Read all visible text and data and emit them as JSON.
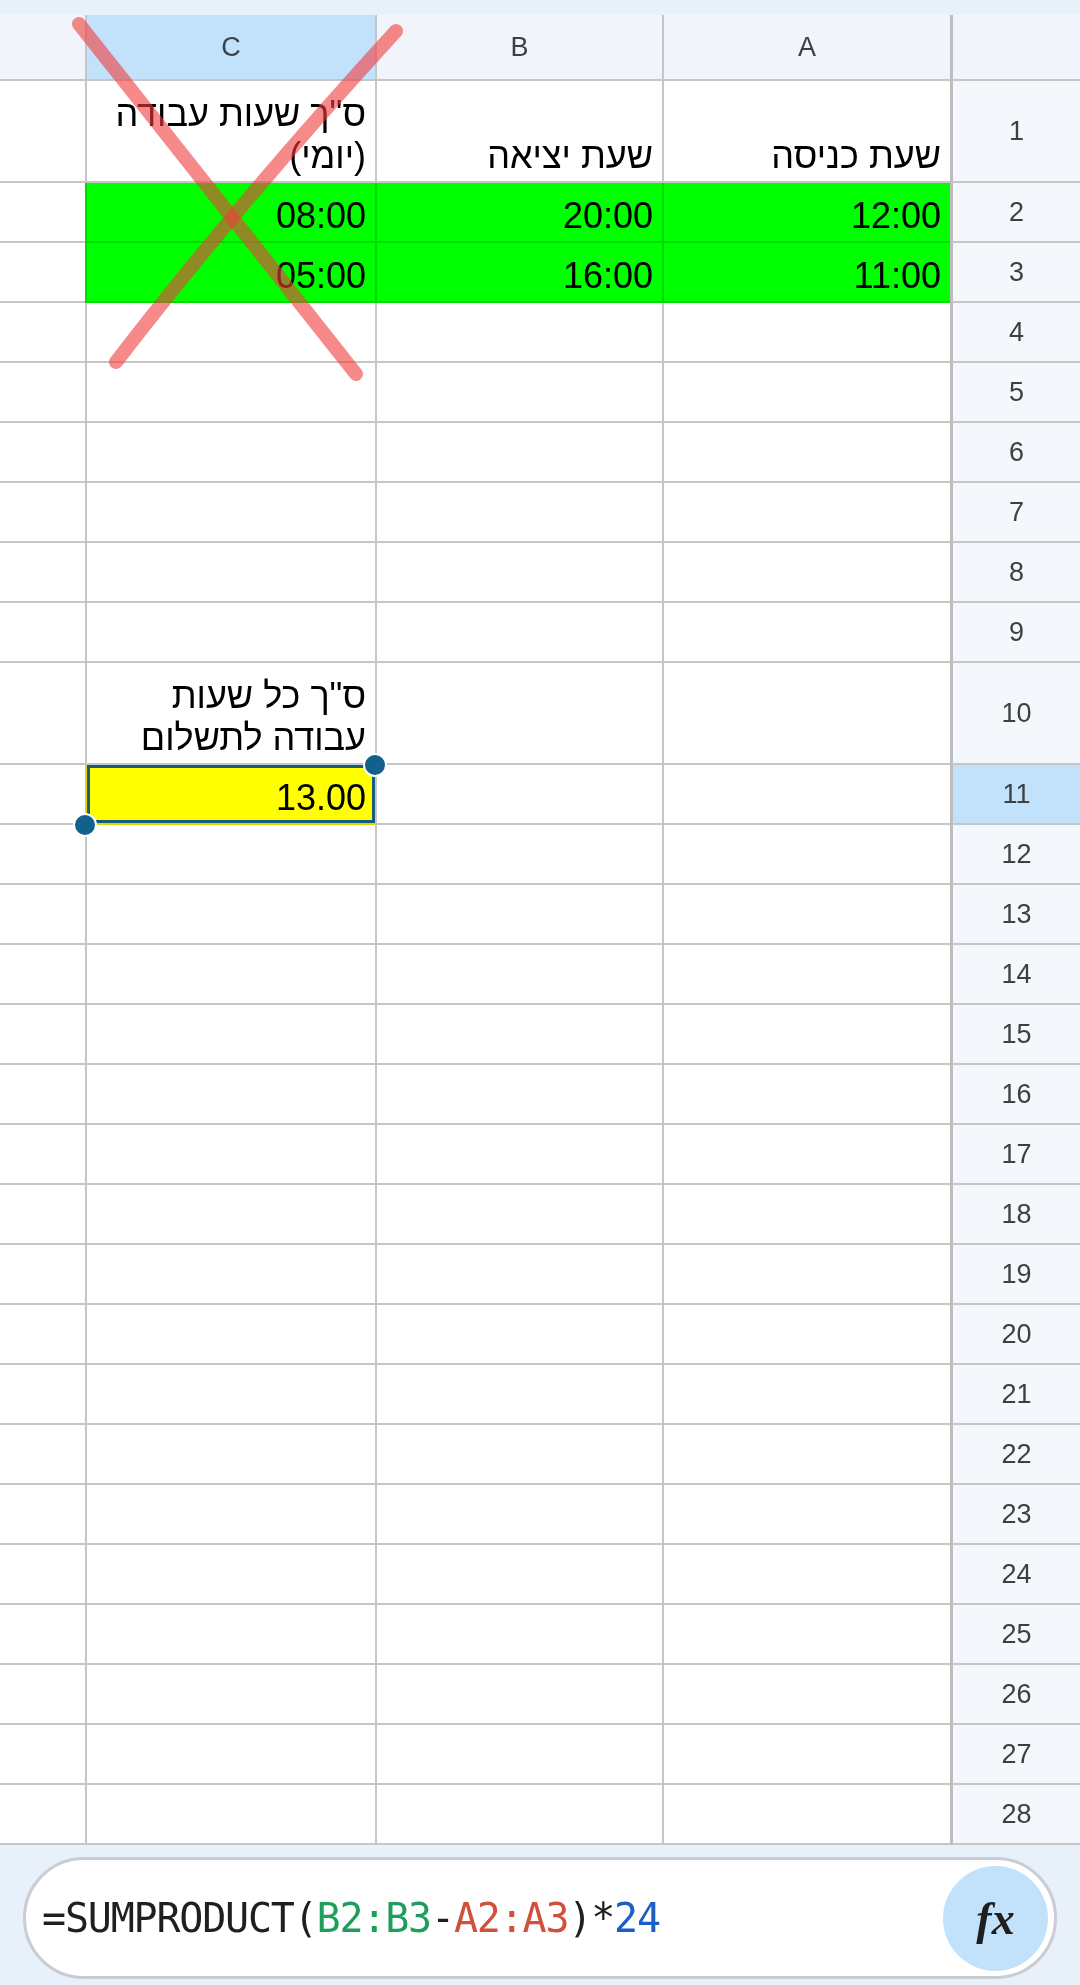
{
  "columns": [
    {
      "label": "A",
      "selected": false
    },
    {
      "label": "B",
      "selected": false
    },
    {
      "label": "C",
      "selected": true
    }
  ],
  "rows": [
    {
      "number": "1",
      "selected": false,
      "cells": [
        {
          "text": "שעת כניסה"
        },
        {
          "text": "שעת יציאה"
        },
        {
          "text": "ס\"ך שעות עבודה (יומי)"
        }
      ]
    },
    {
      "number": "2",
      "selected": false,
      "cells": [
        {
          "text": "12:00",
          "color": "#00ff00"
        },
        {
          "text": "20:00",
          "color": "#00ff00"
        },
        {
          "text": "08:00",
          "color": "#00ff00"
        }
      ]
    },
    {
      "number": "3",
      "selected": false,
      "cells": [
        {
          "text": "11:00",
          "color": "#00ff00"
        },
        {
          "text": "16:00",
          "color": "#00ff00"
        },
        {
          "text": "05:00",
          "color": "#00ff00"
        }
      ]
    },
    {
      "number": "4",
      "selected": false
    },
    {
      "number": "5",
      "selected": false
    },
    {
      "number": "6",
      "selected": false
    },
    {
      "number": "7",
      "selected": false
    },
    {
      "number": "8",
      "selected": false
    },
    {
      "number": "9",
      "selected": false
    },
    {
      "number": "10",
      "selected": false,
      "cells": [
        null,
        null,
        {
          "text": "ס\"ך כל שעות עבודה לתשלום"
        }
      ]
    },
    {
      "number": "11",
      "selected": true,
      "cells": [
        null,
        null,
        {
          "text": "13.00",
          "color": "#ffff00"
        }
      ]
    },
    {
      "number": "12",
      "selected": false
    },
    {
      "number": "13",
      "selected": false
    },
    {
      "number": "14",
      "selected": false
    },
    {
      "number": "15",
      "selected": false
    },
    {
      "number": "16",
      "selected": false
    },
    {
      "number": "17",
      "selected": false
    },
    {
      "number": "18",
      "selected": false
    },
    {
      "number": "19",
      "selected": false
    },
    {
      "number": "20",
      "selected": false
    },
    {
      "number": "21",
      "selected": false
    },
    {
      "number": "22",
      "selected": false
    },
    {
      "number": "23",
      "selected": false
    },
    {
      "number": "24",
      "selected": false
    },
    {
      "number": "25",
      "selected": false
    },
    {
      "number": "26",
      "selected": false
    },
    {
      "number": "27",
      "selected": false
    },
    {
      "number": "28",
      "selected": false
    }
  ],
  "annotation": {
    "kind": "cross"
  },
  "formula_bar": {
    "formula": {
      "function": {
        "text": "=SUMPRODUCT(",
        "color": "#1f1f1f"
      },
      "first_range": {
        "text": "B2:B3",
        "color": "#1e9e5a"
      },
      "operator": {
        "text": "-",
        "color": "#1f1f1f"
      },
      "second_range": {
        "text": "A2:A3",
        "color": "#d1503a"
      },
      "closing": {
        "text": ")*",
        "color": "#1f1f1f"
      },
      "multiplier": {
        "text": "24",
        "color": "#1a5fc4"
      }
    },
    "button": "fx"
  }
}
